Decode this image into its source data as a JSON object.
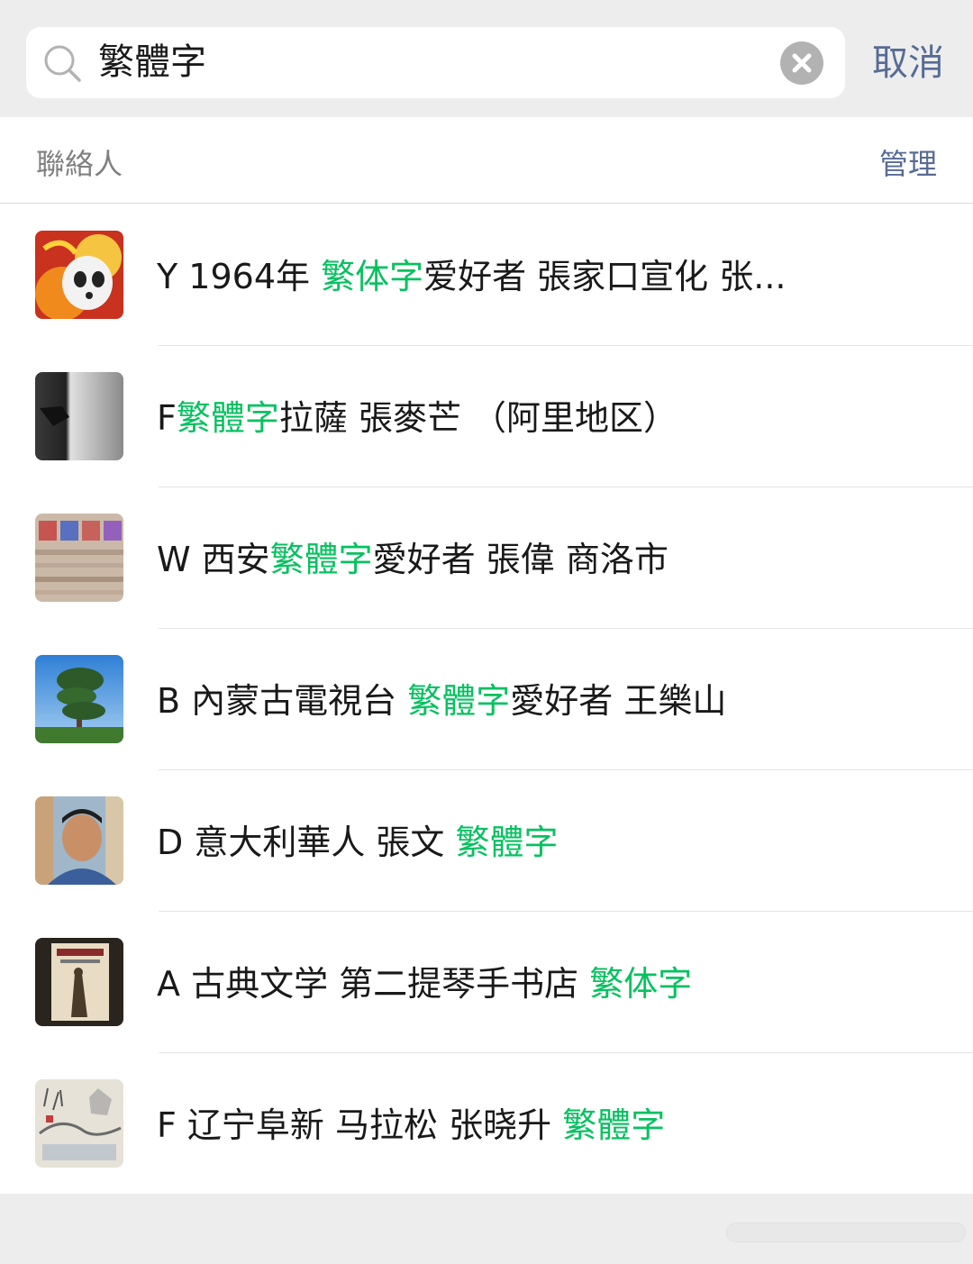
{
  "search": {
    "query": "繁體字",
    "cancel_label": "取消"
  },
  "section": {
    "title": "聯絡人",
    "manage_label": "管理"
  },
  "contacts": [
    {
      "parts": [
        "Y 1964年 ",
        "繁体字",
        "爱好者 張家口宣化 张..."
      ]
    },
    {
      "parts": [
        "F",
        "繁體字",
        "拉薩 張麥芒 （阿里地区）"
      ]
    },
    {
      "parts": [
        "W 西安",
        "繁體字",
        "愛好者 張偉 商洛市"
      ]
    },
    {
      "parts": [
        "B 內蒙古電視台 ",
        "繁體字",
        "愛好者 王樂山"
      ]
    },
    {
      "parts": [
        "D 意大利華人  張文 ",
        "繁體字",
        ""
      ]
    },
    {
      "parts": [
        "A 古典文学 第二提琴手书店  ",
        "繁体字",
        ""
      ]
    },
    {
      "parts": [
        "F 辽宁阜新  马拉松 张晓升 ",
        "繁體字",
        ""
      ]
    }
  ],
  "colors": {
    "highlight": "#07c160",
    "link": "#576b95",
    "background": "#ededed"
  },
  "icons": {
    "search": "search-icon",
    "clear": "clear-icon"
  }
}
